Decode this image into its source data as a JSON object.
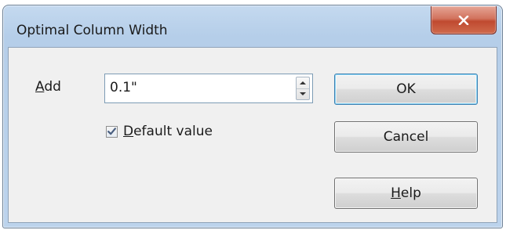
{
  "window": {
    "title": "Optimal Column Width"
  },
  "title_bar": {
    "close_icon": "close-x-icon"
  },
  "form": {
    "add_label_prefix": "A",
    "add_label_rest": "dd",
    "add_value": "0.1\"",
    "default_checked": true,
    "default_label_prefix": "D",
    "default_label_rest": "efault value"
  },
  "buttons": {
    "ok": "OK",
    "cancel": "Cancel",
    "help_prefix": "H",
    "help_rest": "elp"
  },
  "colors": {
    "title_bar": "#bcd3ec",
    "close_button": "#c9573b",
    "dialog_body": "#f0f0f0",
    "default_button_border": "#3c7fb1"
  }
}
